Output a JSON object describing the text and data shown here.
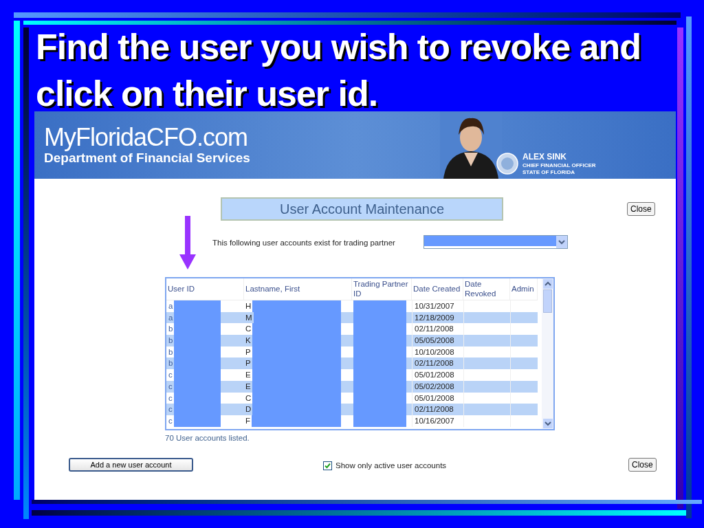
{
  "slide": {
    "title": "Find the user you wish to revoke and click on their user id."
  },
  "banner": {
    "site": "MyFloridaCFO.com",
    "department": "Department of Financial Services",
    "official_name": "ALEX SINK",
    "official_title": "CHIEF FINANCIAL OFFICER",
    "official_state": "STATE OF FLORIDA"
  },
  "page": {
    "heading": "User Account Maintenance",
    "close_top": "Close",
    "partner_label": "This following user accounts exist for trading partner"
  },
  "table": {
    "columns": [
      "User ID",
      "Lastname, First",
      "Trading Partner ID",
      "Date Created",
      "Date Revoked",
      "Admin"
    ],
    "rows": [
      {
        "user_id": "a",
        "name": "H",
        "date_created": "10/31/2007"
      },
      {
        "user_id": "a",
        "name": "M",
        "date_created": "12/18/2009"
      },
      {
        "user_id": "b",
        "name": "C",
        "date_created": "02/11/2008"
      },
      {
        "user_id": "b",
        "name": "K",
        "date_created": "05/05/2008"
      },
      {
        "user_id": "b",
        "name": "P",
        "date_created": "10/10/2008"
      },
      {
        "user_id": "b",
        "name": "P",
        "date_created": "02/11/2008"
      },
      {
        "user_id": "c",
        "name": "E",
        "date_created": "05/01/2008"
      },
      {
        "user_id": "c",
        "name": "E",
        "date_created": "05/02/2008"
      },
      {
        "user_id": "c",
        "name": "C",
        "date_created": "05/01/2008"
      },
      {
        "user_id": "c",
        "name": "D",
        "date_created": "02/11/2008"
      },
      {
        "user_id": "c",
        "name": "F",
        "date_created": "10/16/2007"
      }
    ]
  },
  "count": "70 User accounts listed.",
  "footer": {
    "add_button": "Add a new user account",
    "checkbox": {
      "label": "Show only active user accounts",
      "checked": true
    },
    "close": "Close"
  }
}
